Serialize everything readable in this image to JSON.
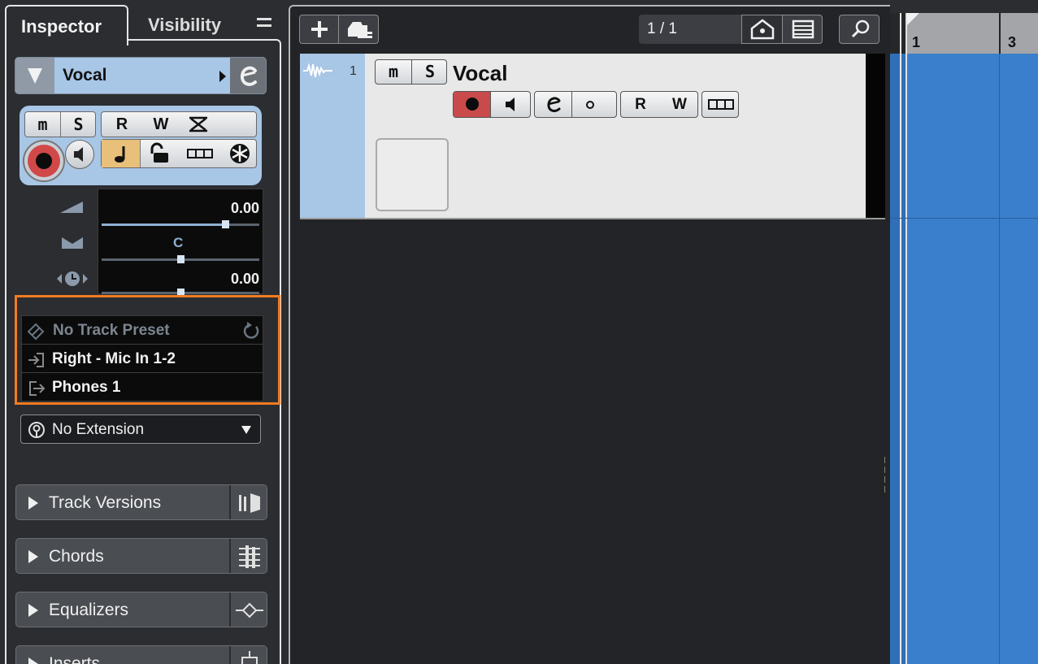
{
  "inspector": {
    "tab_inspector": "Inspector",
    "tab_visibility": "Visibility",
    "track_name": "Vocal",
    "buttons": {
      "mute": "m",
      "solo": "S",
      "read": "R",
      "write": "W"
    },
    "volume_value": "0.00",
    "pan_value": "C",
    "delay_value": "0.00",
    "preset": "No Track Preset",
    "input_routing": "Right - Mic In 1-2",
    "output_routing": "Phones 1",
    "extension": "No Extension",
    "sections": [
      "Track Versions",
      "Chords",
      "Equalizers",
      "Inserts"
    ]
  },
  "toolbar": {
    "counter": "1 / 1"
  },
  "track": {
    "number": "1",
    "name": "Vocal",
    "mute": "m",
    "solo": "S",
    "read": "R",
    "write": "W"
  },
  "ruler": {
    "bar_1": "1",
    "bar_3": "3"
  },
  "colors": {
    "track_color": "#a8c6e6",
    "highlight": "#f37b20",
    "record": "#d14848",
    "event_color": "#3a7fcc"
  }
}
